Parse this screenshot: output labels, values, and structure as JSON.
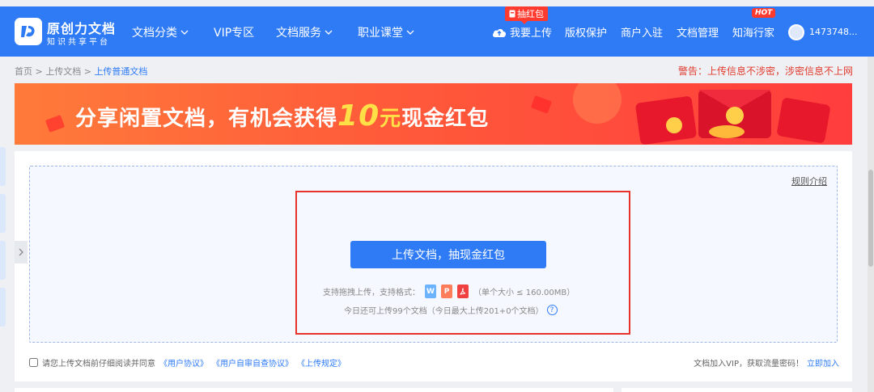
{
  "brand": {
    "title": "原创力文档",
    "subtitle": "知识共享平台"
  },
  "nav": [
    {
      "label": "文档分类",
      "has_dropdown": true
    },
    {
      "label": "VIP专区",
      "has_dropdown": false
    },
    {
      "label": "文档服务",
      "has_dropdown": true
    },
    {
      "label": "职业课堂",
      "has_dropdown": true
    }
  ],
  "header_right": {
    "upload_badge": "抽红包",
    "upload_label": "我要上传",
    "items": [
      "版权保护",
      "商户入驻",
      "文档管理",
      "知海行家"
    ],
    "hot_badge": "HOT",
    "username": "1473748..."
  },
  "breadcrumb": {
    "home": "首页",
    "sep": ">",
    "level1": "上传文档",
    "current": "上传普通文档"
  },
  "warning": "警告：上传信息不涉密，涉密信息不上网",
  "banner": {
    "text_before": "分享闲置文档，有机会获得",
    "amount": "10",
    "unit": "元",
    "text_after": "现金红包"
  },
  "upload": {
    "rule_link": "规则介绍",
    "button_label": "上传文档，抽现金红包",
    "formats_prefix": "支持拖拽上传，支持格式：",
    "formats": [
      "W",
      "P",
      "PDF"
    ],
    "size_limit": "（单个大小 ≤ 160.00MB）",
    "today_quota": "今日还可上传99个文档（今日最大上传201+0个文档）",
    "help_icon": "?"
  },
  "agreement": {
    "prefix": "请您上传文档前仔细阅读并同意",
    "links": [
      "《用户协议》",
      "《用户自审自查协议》",
      "《上传规定》"
    ]
  },
  "vip": {
    "text": "文档加入VIP，获取流量密码！",
    "link": "立即加入"
  },
  "colors": {
    "primary": "#2f7bf6",
    "warning": "#e23b2e",
    "highlight_border": "#e8322c",
    "banner": "#ff5a3a"
  }
}
